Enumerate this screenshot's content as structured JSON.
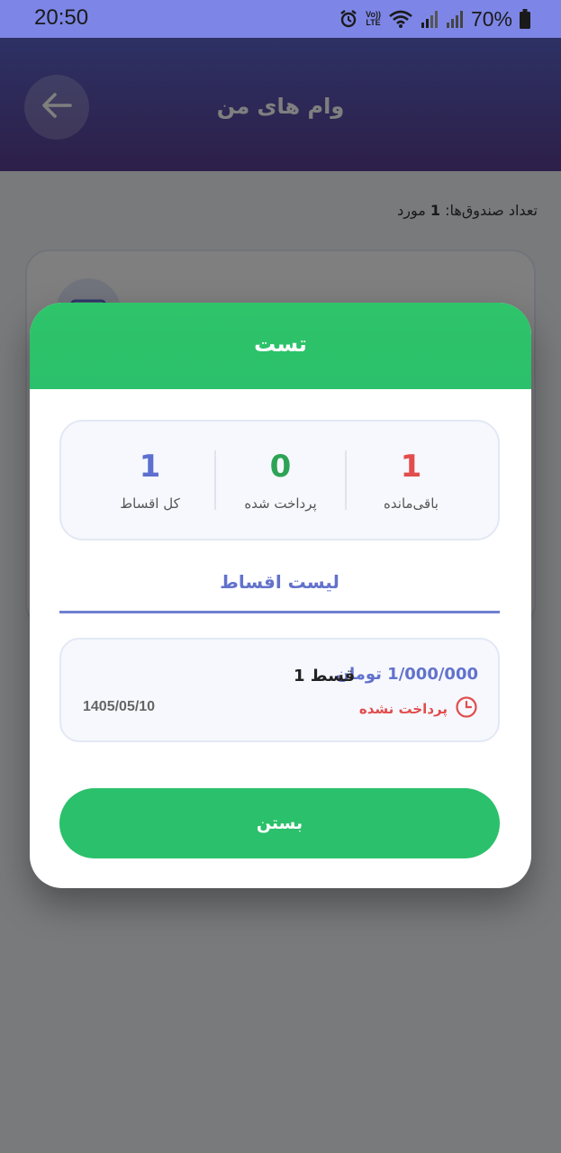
{
  "status_bar": {
    "time": "20:50",
    "volte_top": "Vo))",
    "volte_bottom": "LTE",
    "battery": "70%",
    "icons": [
      "alarm-icon",
      "volte-icon",
      "wifi-icon",
      "signal-icon",
      "signal-icon",
      "battery-icon"
    ]
  },
  "header": {
    "title": "وام های من",
    "back_icon": "arrow-left-icon"
  },
  "page": {
    "count_label": "تعداد صندوق‌ها:",
    "count_value": "1",
    "count_unit": "مورد"
  },
  "modal": {
    "title": "تست",
    "stats": {
      "remaining": {
        "value": "1",
        "label": "باقی‌مانده",
        "color": "#e24d4d"
      },
      "paid": {
        "value": "0",
        "label": "پرداخت شده",
        "color": "#2ea356"
      },
      "total": {
        "value": "1",
        "label": "کل اقساط",
        "color": "#5d6fd0"
      }
    },
    "tab_label": "لیست اقساط",
    "installments": [
      {
        "name": "قسط 1",
        "amount": "1/000/000 تومان",
        "status": "پرداخت نشده",
        "status_icon": "clock-icon",
        "date": "1405/05/10"
      }
    ],
    "close_label": "بستن"
  },
  "colors": {
    "header_gradient_top": "#5a63c9",
    "header_gradient_bottom": "#5a3f92",
    "modal_header": "#2ec46a",
    "accent_blue": "#6272cc",
    "danger": "#e24d4d",
    "button_green": "#2bc06b"
  }
}
